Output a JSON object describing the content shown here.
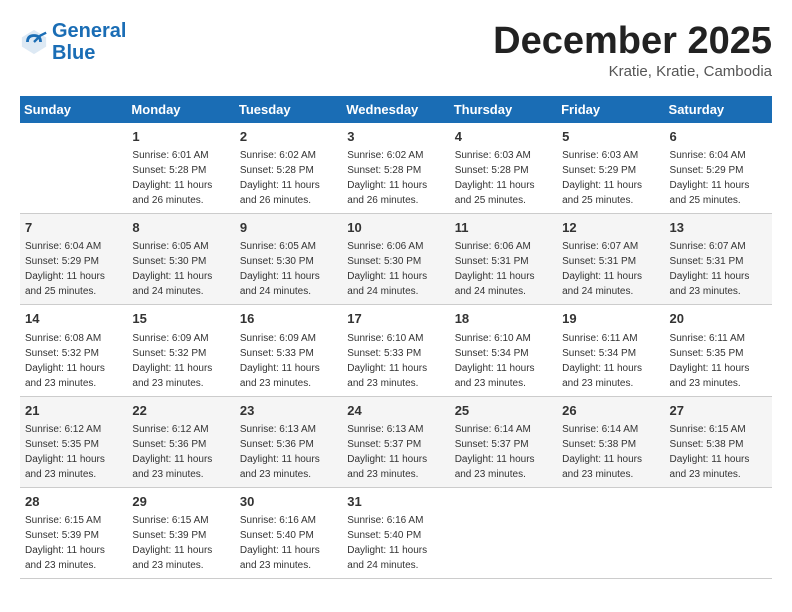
{
  "header": {
    "logo_line1": "General",
    "logo_line2": "Blue",
    "month": "December 2025",
    "location": "Kratie, Kratie, Cambodia"
  },
  "weekdays": [
    "Sunday",
    "Monday",
    "Tuesday",
    "Wednesday",
    "Thursday",
    "Friday",
    "Saturday"
  ],
  "weeks": [
    [
      {
        "day": "",
        "info": ""
      },
      {
        "day": "1",
        "info": "Sunrise: 6:01 AM\nSunset: 5:28 PM\nDaylight: 11 hours\nand 26 minutes."
      },
      {
        "day": "2",
        "info": "Sunrise: 6:02 AM\nSunset: 5:28 PM\nDaylight: 11 hours\nand 26 minutes."
      },
      {
        "day": "3",
        "info": "Sunrise: 6:02 AM\nSunset: 5:28 PM\nDaylight: 11 hours\nand 26 minutes."
      },
      {
        "day": "4",
        "info": "Sunrise: 6:03 AM\nSunset: 5:28 PM\nDaylight: 11 hours\nand 25 minutes."
      },
      {
        "day": "5",
        "info": "Sunrise: 6:03 AM\nSunset: 5:29 PM\nDaylight: 11 hours\nand 25 minutes."
      },
      {
        "day": "6",
        "info": "Sunrise: 6:04 AM\nSunset: 5:29 PM\nDaylight: 11 hours\nand 25 minutes."
      }
    ],
    [
      {
        "day": "7",
        "info": "Sunrise: 6:04 AM\nSunset: 5:29 PM\nDaylight: 11 hours\nand 25 minutes."
      },
      {
        "day": "8",
        "info": "Sunrise: 6:05 AM\nSunset: 5:30 PM\nDaylight: 11 hours\nand 24 minutes."
      },
      {
        "day": "9",
        "info": "Sunrise: 6:05 AM\nSunset: 5:30 PM\nDaylight: 11 hours\nand 24 minutes."
      },
      {
        "day": "10",
        "info": "Sunrise: 6:06 AM\nSunset: 5:30 PM\nDaylight: 11 hours\nand 24 minutes."
      },
      {
        "day": "11",
        "info": "Sunrise: 6:06 AM\nSunset: 5:31 PM\nDaylight: 11 hours\nand 24 minutes."
      },
      {
        "day": "12",
        "info": "Sunrise: 6:07 AM\nSunset: 5:31 PM\nDaylight: 11 hours\nand 24 minutes."
      },
      {
        "day": "13",
        "info": "Sunrise: 6:07 AM\nSunset: 5:31 PM\nDaylight: 11 hours\nand 23 minutes."
      }
    ],
    [
      {
        "day": "14",
        "info": "Sunrise: 6:08 AM\nSunset: 5:32 PM\nDaylight: 11 hours\nand 23 minutes."
      },
      {
        "day": "15",
        "info": "Sunrise: 6:09 AM\nSunset: 5:32 PM\nDaylight: 11 hours\nand 23 minutes."
      },
      {
        "day": "16",
        "info": "Sunrise: 6:09 AM\nSunset: 5:33 PM\nDaylight: 11 hours\nand 23 minutes."
      },
      {
        "day": "17",
        "info": "Sunrise: 6:10 AM\nSunset: 5:33 PM\nDaylight: 11 hours\nand 23 minutes."
      },
      {
        "day": "18",
        "info": "Sunrise: 6:10 AM\nSunset: 5:34 PM\nDaylight: 11 hours\nand 23 minutes."
      },
      {
        "day": "19",
        "info": "Sunrise: 6:11 AM\nSunset: 5:34 PM\nDaylight: 11 hours\nand 23 minutes."
      },
      {
        "day": "20",
        "info": "Sunrise: 6:11 AM\nSunset: 5:35 PM\nDaylight: 11 hours\nand 23 minutes."
      }
    ],
    [
      {
        "day": "21",
        "info": "Sunrise: 6:12 AM\nSunset: 5:35 PM\nDaylight: 11 hours\nand 23 minutes."
      },
      {
        "day": "22",
        "info": "Sunrise: 6:12 AM\nSunset: 5:36 PM\nDaylight: 11 hours\nand 23 minutes."
      },
      {
        "day": "23",
        "info": "Sunrise: 6:13 AM\nSunset: 5:36 PM\nDaylight: 11 hours\nand 23 minutes."
      },
      {
        "day": "24",
        "info": "Sunrise: 6:13 AM\nSunset: 5:37 PM\nDaylight: 11 hours\nand 23 minutes."
      },
      {
        "day": "25",
        "info": "Sunrise: 6:14 AM\nSunset: 5:37 PM\nDaylight: 11 hours\nand 23 minutes."
      },
      {
        "day": "26",
        "info": "Sunrise: 6:14 AM\nSunset: 5:38 PM\nDaylight: 11 hours\nand 23 minutes."
      },
      {
        "day": "27",
        "info": "Sunrise: 6:15 AM\nSunset: 5:38 PM\nDaylight: 11 hours\nand 23 minutes."
      }
    ],
    [
      {
        "day": "28",
        "info": "Sunrise: 6:15 AM\nSunset: 5:39 PM\nDaylight: 11 hours\nand 23 minutes."
      },
      {
        "day": "29",
        "info": "Sunrise: 6:15 AM\nSunset: 5:39 PM\nDaylight: 11 hours\nand 23 minutes."
      },
      {
        "day": "30",
        "info": "Sunrise: 6:16 AM\nSunset: 5:40 PM\nDaylight: 11 hours\nand 23 minutes."
      },
      {
        "day": "31",
        "info": "Sunrise: 6:16 AM\nSunset: 5:40 PM\nDaylight: 11 hours\nand 24 minutes."
      },
      {
        "day": "",
        "info": ""
      },
      {
        "day": "",
        "info": ""
      },
      {
        "day": "",
        "info": ""
      }
    ]
  ]
}
